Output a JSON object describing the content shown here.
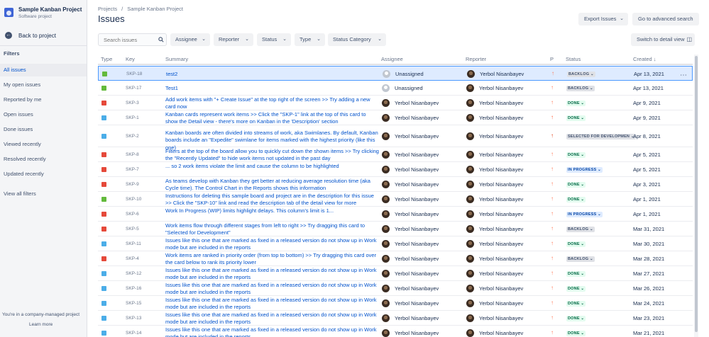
{
  "sidebar": {
    "project_name": "Sample Kanban Project",
    "project_type": "Software project",
    "back_label": "Back to project",
    "filters_heading": "Filters",
    "items": [
      {
        "label": "All issues",
        "active": true
      },
      {
        "label": "My open issues"
      },
      {
        "label": "Reported by me"
      },
      {
        "label": "Open issues"
      },
      {
        "label": "Done issues"
      },
      {
        "label": "Viewed recently"
      },
      {
        "label": "Resolved recently"
      },
      {
        "label": "Updated recently"
      }
    ],
    "view_all": "View all filters",
    "footer_text": "You're in a company-managed project",
    "footer_link": "Learn more"
  },
  "header": {
    "breadcrumbs": [
      "Projects",
      "/",
      "Sample Kanban Project"
    ],
    "title": "Issues",
    "export_label": "Export Issues",
    "advanced_label": "Go to advanced search",
    "detail_view_label": "Switch to detail view"
  },
  "filterbar": {
    "search_placeholder": "Search issues",
    "assignee": "Assignee",
    "reporter": "Reporter",
    "status": "Status",
    "type": "Type",
    "status_category": "Status Category"
  },
  "table": {
    "columns": {
      "type": "Type",
      "key": "Key",
      "summary": "Summary",
      "assignee": "Assignee",
      "reporter": "Reporter",
      "priority": "P",
      "status": "Status",
      "created": "Created"
    },
    "rows": [
      {
        "type": "story",
        "key": "SKP-18",
        "summary": "test2",
        "assignee": "Unassigned",
        "reporter": "Yerbol Nisanbayev",
        "priority": "medium",
        "status": "BACKLOG",
        "created": "Apr 13, 2021"
      },
      {
        "type": "story",
        "key": "SKP-17",
        "summary": "Test1",
        "assignee": "Unassigned",
        "reporter": "Yerbol Nisanbayev",
        "priority": "medium",
        "status": "BACKLOG",
        "created": "Apr 13, 2021"
      },
      {
        "type": "bug",
        "key": "SKP-3",
        "summary": "Add work items with \"+ Create Issue\" at the top right of the screen >> Try adding a new card now",
        "assignee": "Yerbol Nisanbayev",
        "reporter": "Yerbol Nisanbayev",
        "priority": "medium",
        "status": "DONE",
        "created": "Apr 9, 2021"
      },
      {
        "type": "task",
        "key": "SKP-1",
        "summary": "Kanban cards represent work items >> Click the \"SKP-1\" link at the top of this card to show the Detail view - there's more on Kanban in the 'Description' section",
        "assignee": "Yerbol Nisanbayev",
        "reporter": "Yerbol Nisanbayev",
        "priority": "high",
        "status": "DONE",
        "created": "Apr 9, 2021"
      },
      {
        "type": "task",
        "key": "SKP-2",
        "summary": "Kanban boards are often divided into streams of work, aka Swimlanes. By default, Kanban boards include an \"Expedite\" swimlane for items marked with the highest priority (like this one)",
        "assignee": "Yerbol Nisanbayev",
        "reporter": "Yerbol Nisanbayev",
        "priority": "highest",
        "status": "SELECTED FOR DEVELOPMEN",
        "created": "Apr 8, 2021"
      },
      {
        "type": "bug",
        "key": "SKP-8",
        "summary": "Filters at the top of the board allow you to quickly cut down the shown items >> Try clicking the \"Recently Updated\" to hide work items not updated in the past day",
        "assignee": "Yerbol Nisanbayev",
        "reporter": "Yerbol Nisanbayev",
        "priority": "medium",
        "status": "DONE",
        "created": "Apr 5, 2021"
      },
      {
        "type": "bug",
        "key": "SKP-7",
        "summary": "... so 2 work items violate the limit and cause the column to be highlighted",
        "assignee": "Yerbol Nisanbayev",
        "reporter": "Yerbol Nisanbayev",
        "priority": "medium",
        "status": "IN PROGRESS",
        "created": "Apr 5, 2021"
      },
      {
        "type": "bug",
        "key": "SKP-9",
        "summary": "As teams develop with Kanban they get better at reducing average resolution time (aka Cycle time). The Control Chart in the Reports shows this information",
        "assignee": "Yerbol Nisanbayev",
        "reporter": "Yerbol Nisanbayev",
        "priority": "medium",
        "status": "DONE",
        "created": "Apr 3, 2021"
      },
      {
        "type": "story",
        "key": "SKP-10",
        "summary": "Instructions for deleting this sample board and project are in the description for this issue >> Click the \"SKP-10\" link and read the description tab of the detail view for more",
        "assignee": "Yerbol Nisanbayev",
        "reporter": "Yerbol Nisanbayev",
        "priority": "medium",
        "status": "DONE",
        "created": "Apr 1, 2021"
      },
      {
        "type": "bug",
        "key": "SKP-6",
        "summary": "Work In Progress (WIP) limits highlight delays. This column's limit is 1...",
        "assignee": "Yerbol Nisanbayev",
        "reporter": "Yerbol Nisanbayev",
        "priority": "medium",
        "status": "IN PROGRESS",
        "created": "Apr 1, 2021"
      },
      {
        "type": "bug",
        "key": "SKP-5",
        "summary": "Work items flow through different stages from left to right >> Try dragging this card to \"Selected for Development\"",
        "assignee": "Yerbol Nisanbayev",
        "reporter": "Yerbol Nisanbayev",
        "priority": "medium",
        "status": "BACKLOG",
        "created": "Mar 31, 2021"
      },
      {
        "type": "task",
        "key": "SKP-11",
        "summary": "Issues like this one that are marked as fixed in a released version do not show up in Work mode but are included in the reports",
        "assignee": "Yerbol Nisanbayev",
        "reporter": "Yerbol Nisanbayev",
        "priority": "medium",
        "status": "DONE",
        "created": "Mar 30, 2021"
      },
      {
        "type": "bug",
        "key": "SKP-4",
        "summary": "Work items are ranked in priority order (from top to bottom) >> Try dragging this card over the card below to rank its priority lower",
        "assignee": "Yerbol Nisanbayev",
        "reporter": "Yerbol Nisanbayev",
        "priority": "medium",
        "status": "BACKLOG",
        "created": "Mar 28, 2021"
      },
      {
        "type": "task",
        "key": "SKP-12",
        "summary": "Issues like this one that are marked as fixed in a released version do not show up in Work mode but are included in the reports",
        "assignee": "Yerbol Nisanbayev",
        "reporter": "Yerbol Nisanbayev",
        "priority": "medium",
        "status": "DONE",
        "created": "Mar 27, 2021"
      },
      {
        "type": "task",
        "key": "SKP-16",
        "summary": "Issues like this one that are marked as fixed in a released version do not show up in Work mode but are included in the reports",
        "assignee": "Yerbol Nisanbayev",
        "reporter": "Yerbol Nisanbayev",
        "priority": "medium",
        "status": "DONE",
        "created": "Mar 26, 2021"
      },
      {
        "type": "task",
        "key": "SKP-15",
        "summary": "Issues like this one that are marked as fixed in a released version do not show up in Work mode but are included in the reports",
        "assignee": "Yerbol Nisanbayev",
        "reporter": "Yerbol Nisanbayev",
        "priority": "medium",
        "status": "DONE",
        "created": "Mar 24, 2021"
      },
      {
        "type": "task",
        "key": "SKP-13",
        "summary": "Issues like this one that are marked as fixed in a released version do not show up in Work mode but are included in the reports",
        "assignee": "Yerbol Nisanbayev",
        "reporter": "Yerbol Nisanbayev",
        "priority": "medium",
        "status": "DONE",
        "created": "Mar 23, 2021"
      },
      {
        "type": "task",
        "key": "SKP-14",
        "summary": "Issues like this one that are marked as fixed in a released version do not show up in Work mode but are included in the reports",
        "assignee": "Yerbol Nisanbayev",
        "reporter": "Yerbol Nisanbayev",
        "priority": "medium",
        "status": "DONE",
        "created": "Mar 21, 2021"
      }
    ]
  },
  "colors": {
    "link": "#0052cc",
    "priority_medium": "#ff7452",
    "priority_high": "#ff5630",
    "priority_highest": "#de350b"
  },
  "icons": [
    "project-icon",
    "back-arrow-icon",
    "search-icon",
    "chevron-down-icon",
    "more-icon",
    "sort-down-icon",
    "detail-view-icon"
  ]
}
